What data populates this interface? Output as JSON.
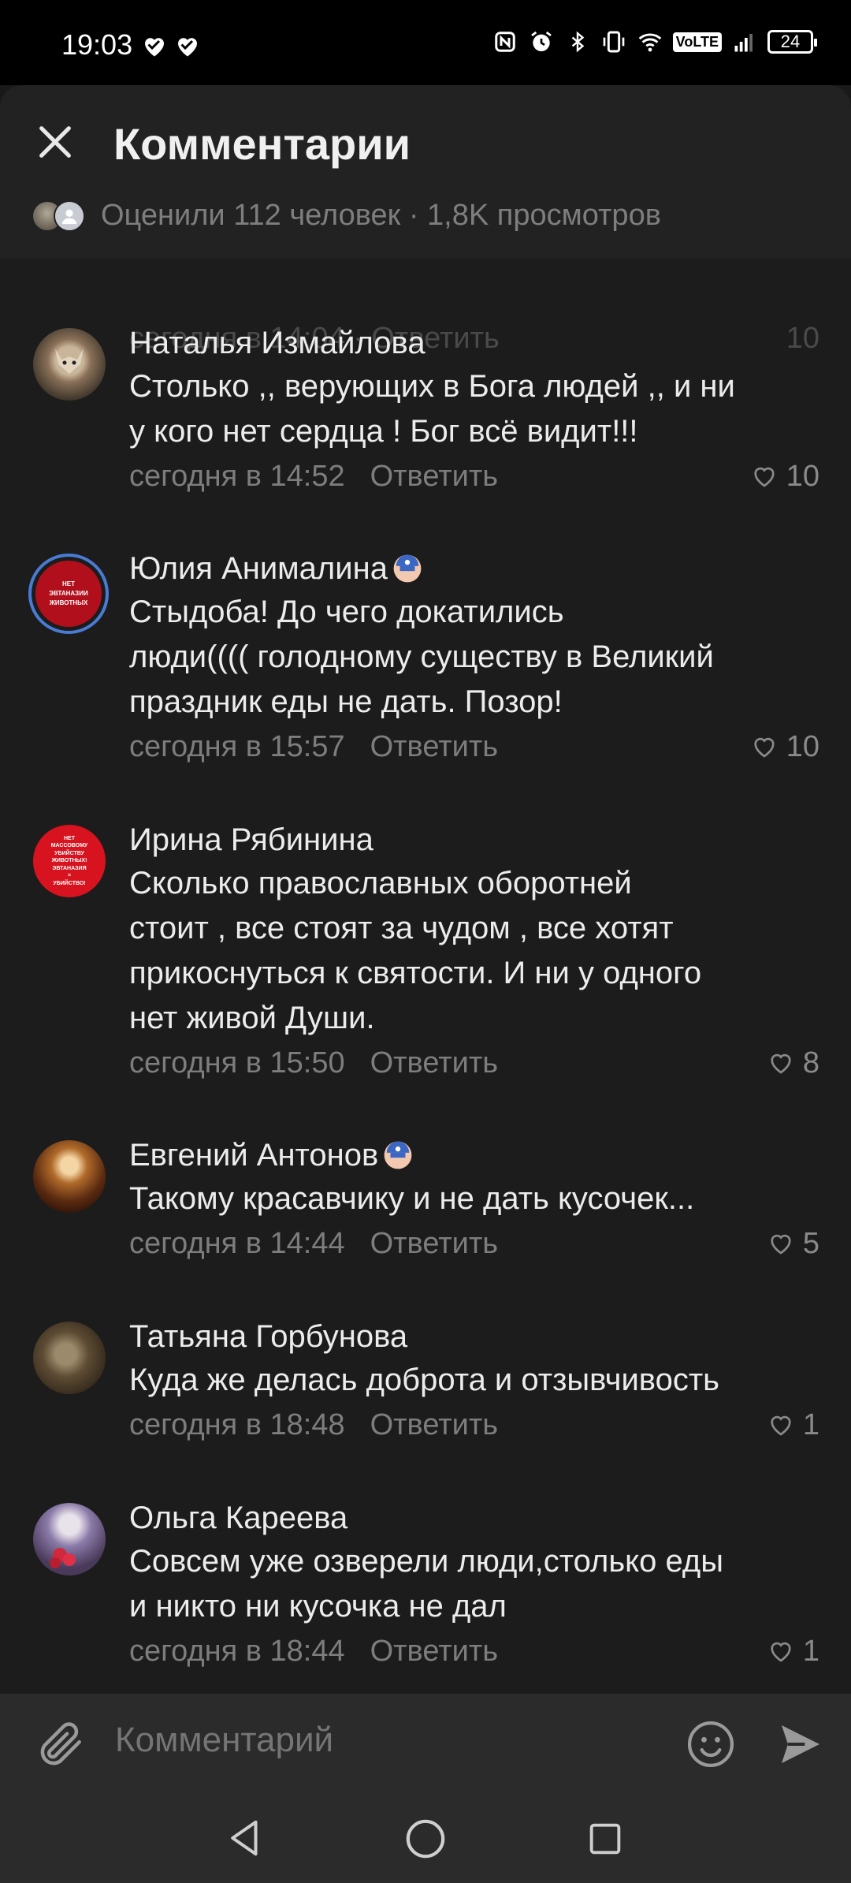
{
  "status": {
    "time": "19:03",
    "volte": "VoLTE",
    "battery": "24"
  },
  "header": {
    "title": "Комментарии",
    "rated_text": "Оценили 112 человек · 1,8K просмотров"
  },
  "ghost_row": {
    "meta": "сегодня в 14:04 · Ответить",
    "likes": "10"
  },
  "comments": [
    {
      "name": "Наталья Измайлова",
      "lines": [
        "Столько ,, верующих в Бога людей ,, и ни",
        "у кого нет сердца ! Бог всё видит!!!"
      ],
      "time": "сегодня в 14:52",
      "reply": "Ответить",
      "likes": "10"
    },
    {
      "name": "Юлия Анималина",
      "lines": [
        "Стыдоба! До чего докатились",
        "люди(((( голодному существу в Великий",
        "праздник еды не дать. Позор!"
      ],
      "time": "сегодня в 15:57",
      "reply": "Ответить",
      "likes": "10",
      "avatar_text": [
        "НЕТ",
        "ЭВТАНАЗИИ",
        "ЖИВОТНЫХ"
      ]
    },
    {
      "name": "Ирина Рябинина",
      "lines": [
        "Сколько православных оборотней",
        "стоит , все стоят за чудом , все хотят",
        "прикоснуться к святости.  И ни у одного",
        "нет живой Души."
      ],
      "time": "сегодня в 15:50",
      "reply": "Ответить",
      "likes": "8",
      "avatar_text": [
        "НЕТ",
        "МАССОВОМУ",
        "УБИЙСТВУ",
        "ЖИВОТНЫХ!",
        "ЭВТАНАЗИЯ",
        "=",
        "УБИЙСТВО!"
      ]
    },
    {
      "name": "Евгений Антонов",
      "lines": [
        "Такому красавчику и не дать кусочек..."
      ],
      "time": "сегодня в 14:44",
      "reply": "Ответить",
      "likes": "5"
    },
    {
      "name": "Татьяна Горбунова",
      "lines": [
        "Куда же делась доброта и отзывчивость"
      ],
      "time": "сегодня в 18:48",
      "reply": "Ответить",
      "likes": "1"
    },
    {
      "name": "Ольга Кареева",
      "lines": [
        "Совсем уже озверели люди,столько еды",
        "и никто ни кусочка не дал"
      ],
      "time": "сегодня в 18:44",
      "reply": "Ответить",
      "likes": "1"
    }
  ],
  "composer": {
    "placeholder": "Комментарий"
  },
  "colors": {
    "background": "#191919",
    "header": "#222222",
    "composer": "#2b2b2b",
    "muted": "#7d7d7d",
    "badge": "#4a7bd4"
  }
}
